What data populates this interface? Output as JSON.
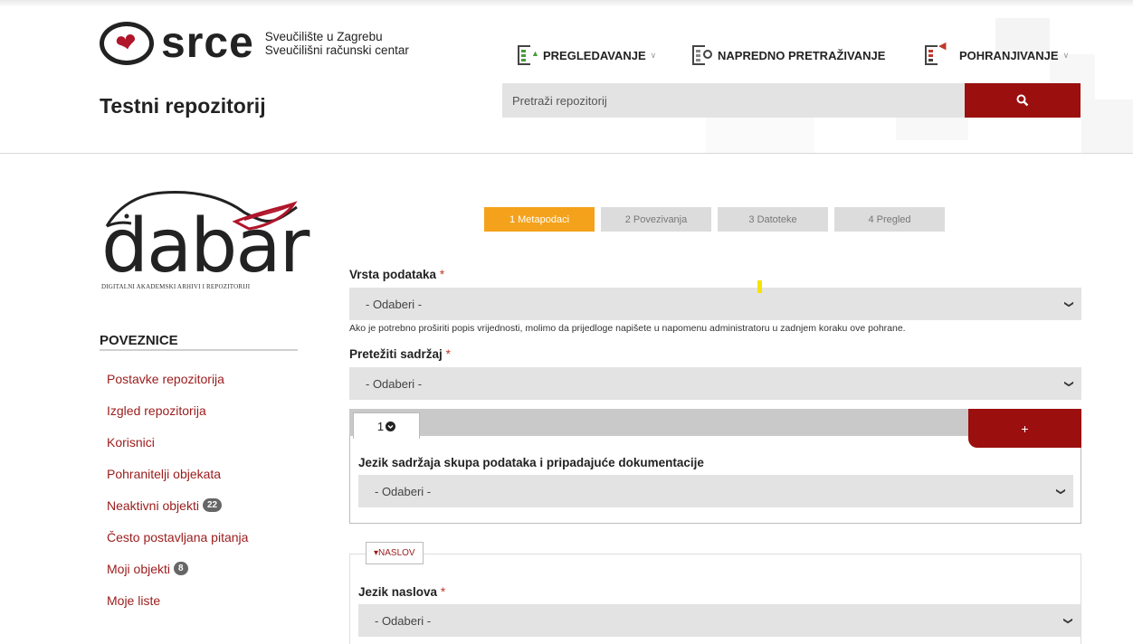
{
  "header": {
    "logo_word": "srce",
    "logo_sub_line1": "Sveučilište u Zagrebu",
    "logo_sub_line2": "Sveučilišni računski centar",
    "site_title": "Testni repozitorij",
    "nav": [
      {
        "label": "PREGLEDAVANJE",
        "icon": "browse-icon",
        "has_dropdown": true
      },
      {
        "label": "NAPREDNO PRETRAŽIVANJE",
        "icon": "advanced-search-icon",
        "has_dropdown": false
      },
      {
        "label": "POHRANJIVANJE",
        "icon": "deposit-icon",
        "has_dropdown": true
      }
    ],
    "search_placeholder": "Pretraži repozitorij",
    "search_icon": "search-icon"
  },
  "sidebar": {
    "logo_word": "dabar",
    "logo_sub": "DIGITALNI AKADEMSKI ARHIVI I REPOZITORIJI",
    "title": "POVEZNICE",
    "links": [
      {
        "label": "Postavke repozitorija"
      },
      {
        "label": "Izgled repozitorija"
      },
      {
        "label": "Korisnici"
      },
      {
        "label": "Pohranitelji objekata"
      },
      {
        "label": "Neaktivni objekti",
        "badge": "22"
      },
      {
        "label": "Često postavljana pitanja"
      },
      {
        "label": "Moji objekti",
        "badge": "8"
      },
      {
        "label": "Moje liste"
      }
    ]
  },
  "steps": [
    {
      "label": "1 Metapodaci",
      "active": true
    },
    {
      "label": "2 Povezivanja",
      "active": false
    },
    {
      "label": "3 Datoteke",
      "active": false
    },
    {
      "label": "4 Pregled",
      "active": false
    }
  ],
  "form": {
    "vrsta_label": "Vrsta podataka",
    "vrsta_value": "- Odaberi -",
    "hint": "Ako je potrebno proširiti popis vrijednosti, molimo da prijedloge napišete u napomenu administratoru u zadnjem koraku ove pohrane.",
    "pretezni_label": "Pretežiti sadržaj",
    "pretezni_value": "- Odaberi -",
    "tab_label": "1",
    "plus_label": "+",
    "jezik_sadrzaja_label": "Jezik sadržaja skupa podataka i pripadajuće dokumentacije",
    "jezik_sadrzaja_value": "- Odaberi -",
    "naslov_legend": "▾NASLOV",
    "jezik_naslova_label": "Jezik naslova",
    "jezik_naslova_value": "- Odaberi -",
    "required_mark": "*"
  },
  "colors": {
    "accent_red": "#9b0f0f",
    "link_red": "#9b1b1b",
    "step_active": "#f4a21b"
  }
}
